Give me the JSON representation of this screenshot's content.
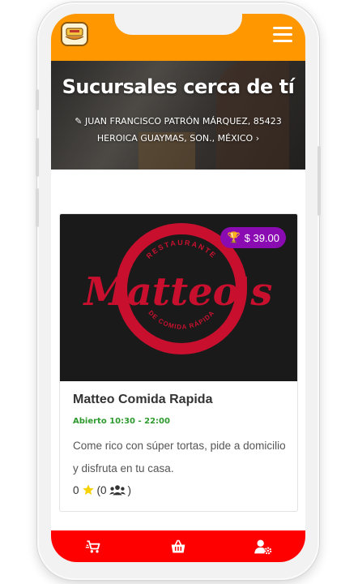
{
  "header": {
    "logo_icon": "restaurant-logo-icon",
    "menu_icon": "hamburger-menu-icon",
    "accent_color": "#ff9800"
  },
  "hero": {
    "title": "Sucursales cerca de tí",
    "address_line1": "JUAN FRANCISCO PATRÓN MÁRQUEZ, 85423",
    "address_line2": "HEROICA GUAYMAS, SON., MÉXICO",
    "edit_icon": "pencil-icon",
    "chevron_icon": "chevron-right-icon"
  },
  "restaurant_card": {
    "image_text_top": "RESTAURANTE",
    "image_brand": "Matteo's",
    "image_text_bottom": "DE COMIDA RÁPIDA",
    "price": "$ 39.00",
    "price_icon": "trophy-icon",
    "price_color": "#8b0bb3",
    "title": "Matteo Comida Rapida",
    "status": "Abierto 10:30 - 22:00",
    "status_color": "#2e9a2e",
    "description": "Come rico con súper tortas, pide a domicilio y disfruta en tu casa.",
    "rating_value": "0",
    "rating_icon": "star-icon",
    "reviews_open": "(0",
    "reviews_icon": "users-icon",
    "reviews_close": ")"
  },
  "bottom_nav": {
    "color": "#ff0000",
    "items": [
      {
        "icon": "delivery-cart-icon"
      },
      {
        "icon": "basket-icon"
      },
      {
        "icon": "user-settings-icon"
      }
    ]
  }
}
